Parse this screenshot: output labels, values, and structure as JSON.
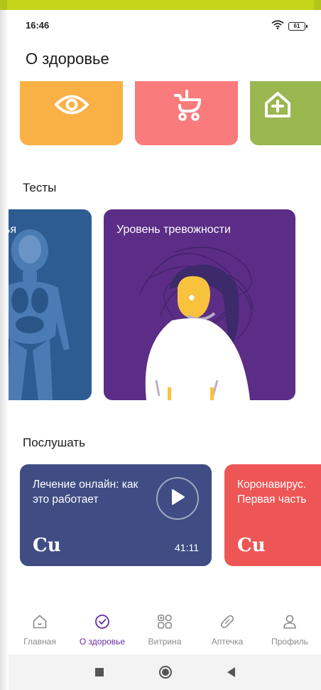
{
  "status": {
    "time": "16:46",
    "battery": "61",
    "icons": [
      "wifi-icon",
      "battery-icon"
    ]
  },
  "page": {
    "title": "О здоровье"
  },
  "categories": [
    {
      "icon": "eye-icon",
      "color": "#f9b045"
    },
    {
      "icon": "baby-stroller-icon",
      "color": "#f97b7b"
    },
    {
      "icon": "medical-home-icon",
      "color": "#9ab750"
    }
  ],
  "tests": {
    "title": "Тесты",
    "cards": [
      {
        "label": "ья",
        "color": "#2c5c92"
      },
      {
        "label": "Уровень тревожности",
        "color": "#5b2d86"
      }
    ]
  },
  "listen": {
    "title": "Послушать",
    "cards": [
      {
        "title": "Лечение онлайн: как это работает",
        "logo": "Cu",
        "duration": "41:11",
        "color": "#3f4d84"
      },
      {
        "title": "Коронавирус. Первая часть",
        "logo": "Cu",
        "color": "#ee5656"
      }
    ]
  },
  "nav": {
    "items": [
      {
        "label": "Главная",
        "icon": "home-icon"
      },
      {
        "label": "О здоровье",
        "icon": "check-circle-icon",
        "active": true
      },
      {
        "label": "Витрина",
        "icon": "grid-plus-icon"
      },
      {
        "label": "Аптечка",
        "icon": "pill-icon"
      },
      {
        "label": "Профиль",
        "icon": "profile-icon"
      }
    ],
    "active_color": "#6a2aa8"
  }
}
